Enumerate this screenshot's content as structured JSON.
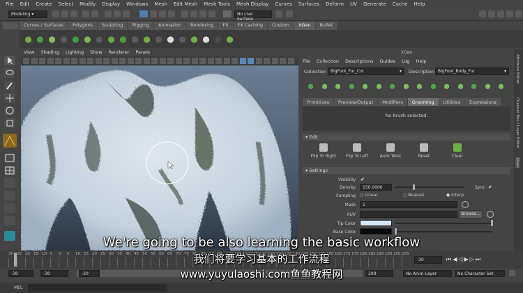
{
  "menubar": [
    "File",
    "Edit",
    "Create",
    "Select",
    "Modify",
    "Display",
    "Windows",
    "Mesh",
    "Edit Mesh",
    "Mesh Tools",
    "Mesh Display",
    "Curves",
    "Surfaces",
    "Deform",
    "UV",
    "Generate",
    "Cache",
    "Help"
  ],
  "status": {
    "mode": "Modeling",
    "live": "No Live Surface",
    "symmetry": "Symmetry: Off"
  },
  "shelf_tabs": [
    "Curves / Surfaces",
    "Polygons",
    "Sculpting",
    "Rigging",
    "Animation",
    "Rendering",
    "FX",
    "FX Caching",
    "Custom",
    "XGen",
    "Bullet"
  ],
  "shelf_active": "XGen",
  "viewport_menu": [
    "View",
    "Shading",
    "Lighting",
    "Show",
    "Renderer",
    "Panels"
  ],
  "xgen": {
    "title": "XGen",
    "menu": [
      "File",
      "Collection",
      "Descriptions",
      "Guides",
      "Log",
      "Help"
    ],
    "collection_label": "Collection",
    "collection_value": "BigFoot_Fur_Col",
    "description_label": "Description",
    "description_value": "BigFoot_Body_Fur",
    "tabs": [
      "Primitives",
      "Preview/Output",
      "Modifiers",
      "Grooming",
      "Utilities",
      "Expressions"
    ],
    "active_tab": "Grooming",
    "no_brush": "No brush selected.",
    "edit_header": "Edit",
    "edit_buttons": [
      "Flip To Right",
      "Flip To Left",
      "Auto Twist",
      "Reset",
      "Clear"
    ],
    "settings_header": "Settings",
    "visibility_label": "Visibility",
    "density_label": "Density",
    "density_value": "150.0000",
    "sync_label": "Sync",
    "sampling_label": "Sampling",
    "sampling_options": [
      "Linear",
      "Nearest",
      "Interp"
    ],
    "mask_label": "Mask",
    "mask_value": "1",
    "xuv_label": "XUV",
    "browse_label": "Browse...",
    "tip_color_label": "Tip Color",
    "base_color_label": "Base Color"
  },
  "right_strip": [
    "Attribute Editor",
    "Channel Box / Layer Editor",
    "XGen"
  ],
  "timeline": {
    "ticks": [
      "30",
      "25",
      "20",
      "15",
      "10",
      "5",
      "0",
      "5",
      "10",
      "15",
      "20",
      "25",
      "30",
      "35",
      "40",
      "45",
      "50",
      "55",
      "60",
      "65",
      "70",
      "75",
      "80",
      "85",
      "90",
      "95",
      "100",
      "105",
      "110",
      "115",
      "120",
      "125",
      "130",
      "135",
      "140",
      "145",
      "150",
      "155",
      "160",
      "165",
      "170",
      "175",
      "180",
      "185",
      "190",
      "195",
      "200",
      "205"
    ],
    "current_frame": "-30"
  },
  "range": {
    "start": "-30",
    "start2": "-30",
    "current": "-30",
    "end": "200",
    "anim_layer": "No Anim Layer",
    "character_set": "No Character Set"
  },
  "cmd_label": "MEL",
  "subtitles": {
    "en": "We're going to be also learning the basic workflow",
    "zh": "我们将要学习基本的工作流程",
    "watermark": "www.yuyulaoshi.com鱼鱼教程网"
  }
}
